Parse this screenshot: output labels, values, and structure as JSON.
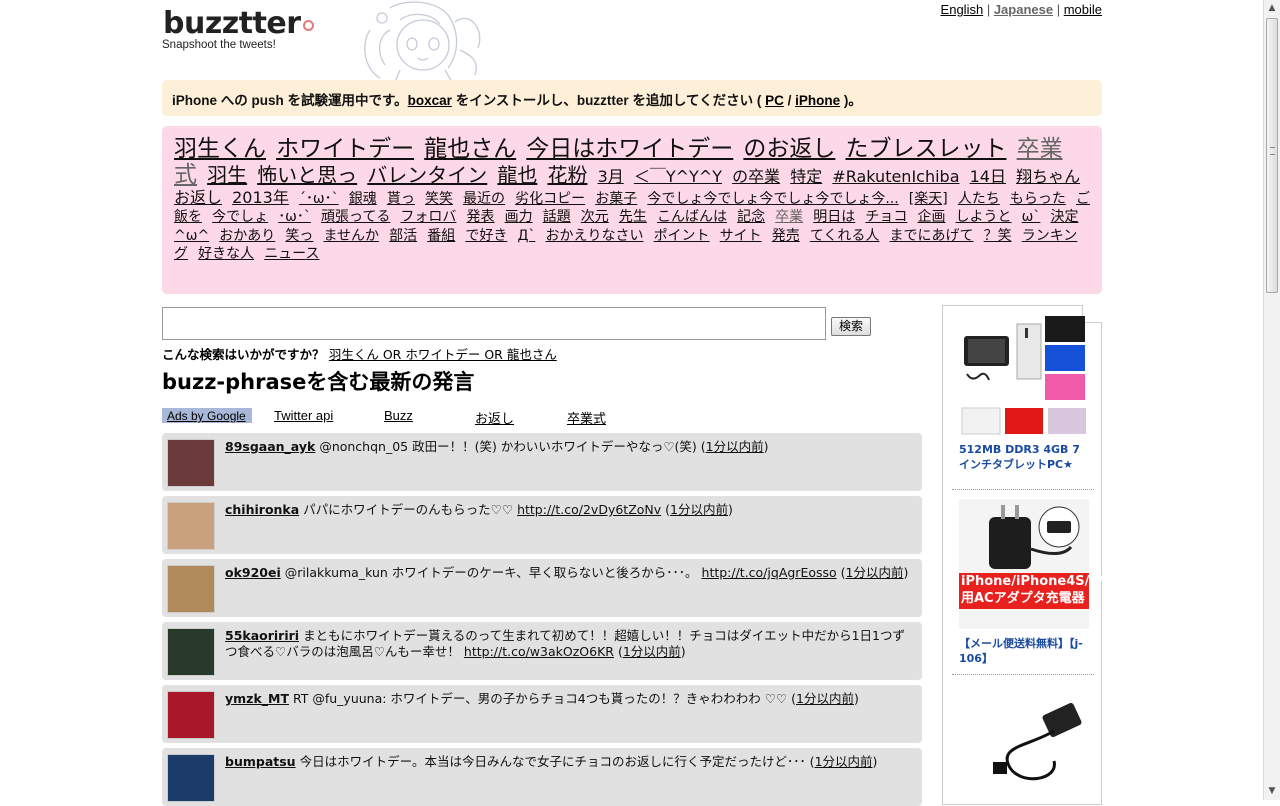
{
  "header": {
    "logo": "buzztter",
    "tagline": "Snapshoot the tweets!",
    "lang_links": [
      "English",
      "Japanese",
      "mobile"
    ]
  },
  "notice": {
    "pre": "iPhone への push を試験運用中です。",
    "link1": "boxcar",
    "mid": " をインストールし、buzztter を追加してください ( ",
    "link2": "PC",
    "sep": " / ",
    "link3": "iPhone",
    "post": " )。"
  },
  "cloud": [
    {
      "t": "羽生くん",
      "s": 1
    },
    {
      "t": "ホワイトデー",
      "s": 1
    },
    {
      "t": "龍也さん",
      "s": 1
    },
    {
      "t": "今日はホワイトデー",
      "s": 1
    },
    {
      "t": "のお返し",
      "s": 1
    },
    {
      "t": "たブレスレット",
      "s": 1
    },
    {
      "t": "卒業式",
      "s": 1,
      "gray": true
    },
    {
      "t": "羽生",
      "s": 2
    },
    {
      "t": "怖いと思っ",
      "s": 2
    },
    {
      "t": "バレンタイン",
      "s": 2
    },
    {
      "t": "龍也",
      "s": 2
    },
    {
      "t": "花粉",
      "s": 2
    },
    {
      "t": "3月",
      "s": 3
    },
    {
      "t": "＜￣Y^Y^Y",
      "s": 3
    },
    {
      "t": "の卒業",
      "s": 3
    },
    {
      "t": "特定",
      "s": 3
    },
    {
      "t": "#RakutenIchiba",
      "s": 3
    },
    {
      "t": "14日",
      "s": 3
    },
    {
      "t": "翔ちゃん",
      "s": 3
    },
    {
      "t": "お返し",
      "s": 3
    },
    {
      "t": "2013年",
      "s": 3
    },
    {
      "t": "´･ω･`",
      "s": 4
    },
    {
      "t": "銀魂",
      "s": 4
    },
    {
      "t": "貰っ",
      "s": 4
    },
    {
      "t": "笑笑",
      "s": 4
    },
    {
      "t": "最近の",
      "s": 4
    },
    {
      "t": "劣化コピー",
      "s": 4
    },
    {
      "t": "お菓子",
      "s": 4
    },
    {
      "t": "今でしょ今でしょ今でしょ今でしょ今...",
      "s": 4
    },
    {
      "t": "[楽天]",
      "s": 4
    },
    {
      "t": "人たち",
      "s": 4
    },
    {
      "t": "もらった",
      "s": 4
    },
    {
      "t": "ご飯を",
      "s": 4
    },
    {
      "t": "今でしょ",
      "s": 4
    },
    {
      "t": "･ω･`",
      "s": 4
    },
    {
      "t": "頑張ってる",
      "s": 4
    },
    {
      "t": "フォロバ",
      "s": 4
    },
    {
      "t": "発表",
      "s": 4
    },
    {
      "t": "画力",
      "s": 4
    },
    {
      "t": "話題",
      "s": 4
    },
    {
      "t": "次元",
      "s": 4
    },
    {
      "t": "先生",
      "s": 4
    },
    {
      "t": "こんばんは",
      "s": 4
    },
    {
      "t": "記念",
      "s": 4
    },
    {
      "t": "卒業",
      "s": 4,
      "gray": true
    },
    {
      "t": "明日は",
      "s": 4
    },
    {
      "t": "チョコ",
      "s": 4
    },
    {
      "t": "企画",
      "s": 4
    },
    {
      "t": "しようと",
      "s": 4
    },
    {
      "t": "ω`",
      "s": 4
    },
    {
      "t": "決定",
      "s": 4
    },
    {
      "t": "^ω^",
      "s": 4
    },
    {
      "t": "おかあり",
      "s": 4
    },
    {
      "t": "笑っ",
      "s": 4
    },
    {
      "t": "ませんか",
      "s": 4
    },
    {
      "t": "部活",
      "s": 4
    },
    {
      "t": "番組",
      "s": 4
    },
    {
      "t": "で好き",
      "s": 4
    },
    {
      "t": "Д`",
      "s": 4
    },
    {
      "t": "おかえりなさい",
      "s": 4
    },
    {
      "t": "ポイント",
      "s": 4
    },
    {
      "t": "サイト",
      "s": 4
    },
    {
      "t": "発売",
      "s": 4
    },
    {
      "t": "てくれる人",
      "s": 4
    },
    {
      "t": "までにあげて",
      "s": 4
    },
    {
      "t": "？笑",
      "s": 4
    },
    {
      "t": "ランキング",
      "s": 4
    },
    {
      "t": "好きな人",
      "s": 4
    },
    {
      "t": "ニュース",
      "s": 4
    }
  ],
  "search": {
    "placeholder": "",
    "button": "検索",
    "suggest_label": "こんな検索はいかがですか？",
    "suggest_link": "羽生くん OR ホワイトデー OR 龍也さん"
  },
  "section_title": "buzz-phraseを含む最新の発言",
  "tabs": {
    "ads": "Ads by Google",
    "items": [
      "Twitter api",
      "Buzz",
      "お返し",
      "卒業式"
    ]
  },
  "tweets": [
    {
      "user": "89sgaan_ayk",
      "text": "@nonchqn_05 政田ー！！(笑) かわいいホワイトデーやなっ♡(笑)",
      "link": "",
      "time": "1分以内前",
      "avatar_color": "#6b3a3a"
    },
    {
      "user": "chihironka",
      "text": "パパにホワイトデーのんもらった♡♡",
      "link": "http://t.co/2vDy6tZoNv",
      "time": "1分以内前",
      "avatar_color": "#c9a17c"
    },
    {
      "user": "ok920ei",
      "text": "@rilakkuma_kun ホワイトデーのケーキ、早く取らないと後ろから･･･。",
      "link": "http://t.co/jqAgrEosso",
      "time": "1分以内前",
      "avatar_color": "#b08a5a"
    },
    {
      "user": "55kaoririri",
      "text": "まともにホワイトデー貰えるのって生まれて初めて！！超嬉しい！！チョコはダイエット中だから1日1つずつ食べる♡バラのは泡風呂♡んもー幸せ！",
      "link": "http://t.co/w3akOzO6KR",
      "time": "1分以内前",
      "avatar_color": "#2a3a2a"
    },
    {
      "user": "ymzk_MT",
      "text": "RT @fu_yuuna: ホワイトデー、男の子からチョコ4つも貰ったの！？きゃわわわわ ♡♡",
      "link": "",
      "time": "1分以内前",
      "avatar_color": "#a8182a"
    },
    {
      "user": "bumpatsu",
      "text": "今日はホワイトデー。本当は今日みんなで女子にチョコのお返しに行く予定だったけど･･･",
      "link": "",
      "time": "1分以内前",
      "avatar_color": "#1b3c6a"
    }
  ],
  "ads": [
    {
      "caption": "512MB DDR3 4GB 7インチタブレットPC★"
    },
    {
      "caption": "【メール便送料無料】【j-106】",
      "banner": "iPhone/iPhone4S/iPad/iPod用ACアダプタ充電器"
    }
  ]
}
